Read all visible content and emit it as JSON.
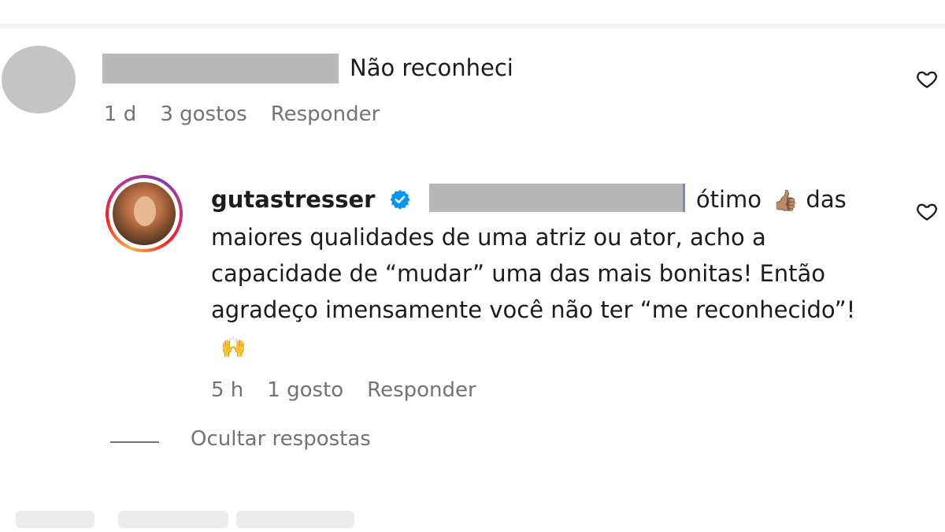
{
  "top_comment": {
    "text": "Não reconheci",
    "meta": {
      "time": "1 d",
      "likes": "3 gostos",
      "reply": "Responder"
    }
  },
  "reply_comment": {
    "username": "gutastresser",
    "text_part1": "ótimo",
    "text_part2": "das maiores qualidades de uma atriz ou ator, acho a capacidade de “mudar” uma das mais bonitas! Então agradeço imensamente você não ter “me reconhecido”!",
    "emoji_1": "👍🏽",
    "emoji_2": "🙌",
    "meta": {
      "time": "5 h",
      "likes": "1 gosto",
      "reply": "Responder"
    }
  },
  "hide_replies": "Ocultar respostas",
  "icons": {
    "like": "heart-icon",
    "verified": "verified-badge-icon"
  },
  "colors": {
    "text": "#1c1c1c",
    "meta": "#737373",
    "verified": "#0095f6",
    "redaction": "#b9b9b9"
  }
}
